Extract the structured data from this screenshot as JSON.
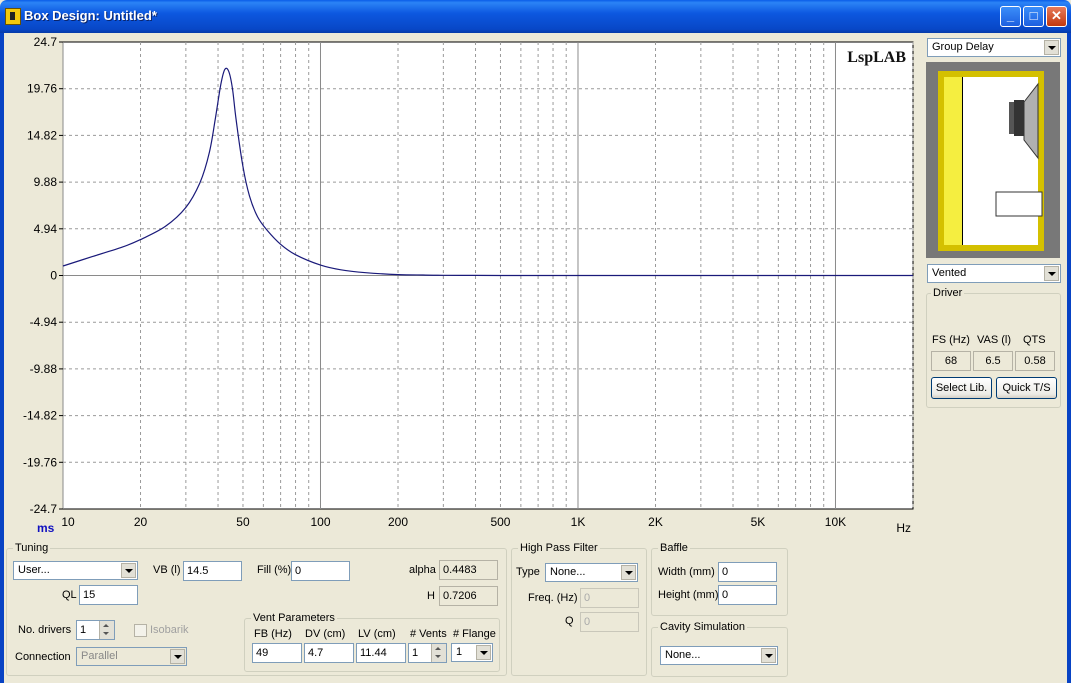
{
  "window": {
    "title": "Box Design: Untitled*",
    "minimize": "_",
    "maximize": "□",
    "close": "✕"
  },
  "chart": {
    "watermark": "LspLAB",
    "y_unit": "ms",
    "x_unit": "Hz"
  },
  "chart_data": {
    "type": "line",
    "title": "",
    "xlabel": "Hz",
    "ylabel": "ms",
    "x_scale": "log",
    "xlim": [
      10,
      20000
    ],
    "ylim": [
      -24.7,
      24.7
    ],
    "grid": true,
    "y_ticks": [
      "24.7",
      "19.76",
      "14.82",
      "9.88",
      "4.94",
      "0",
      "-4.94",
      "-9.88",
      "-14.82",
      "-19.76",
      "-24.7"
    ],
    "x_ticks": [
      {
        "v": 10,
        "label": "10"
      },
      {
        "v": 20,
        "label": "20"
      },
      {
        "v": 50,
        "label": "50"
      },
      {
        "v": 100,
        "label": "100"
      },
      {
        "v": 200,
        "label": "200"
      },
      {
        "v": 500,
        "label": "500"
      },
      {
        "v": 1000,
        "label": "1K"
      },
      {
        "v": 2000,
        "label": "2K"
      },
      {
        "v": 5000,
        "label": "5K"
      },
      {
        "v": 10000,
        "label": "10K"
      }
    ],
    "series": [
      {
        "color": "#1a1a7a",
        "x": [
          10,
          13,
          17,
          20,
          25,
          30,
          34,
          37,
          39,
          41,
          42.5,
          44,
          45.5,
          47,
          50,
          53,
          57,
          62,
          70,
          80,
          100,
          120,
          150,
          200,
          250,
          300,
          400,
          500,
          600,
          1000,
          2000,
          5000,
          20000
        ],
        "y": [
          1.0,
          2.0,
          3.0,
          3.8,
          5.2,
          7.2,
          9.8,
          13.0,
          16.5,
          20.2,
          21.8,
          21.6,
          19.8,
          16.5,
          11.5,
          8.4,
          6.2,
          4.8,
          3.3,
          2.2,
          1.1,
          0.6,
          0.3,
          0.1,
          0.05,
          0.02,
          0.01,
          0.0,
          0.0,
          0.0,
          0.0,
          0.0,
          0.0
        ]
      }
    ]
  },
  "right": {
    "graph_select": "Group Delay",
    "box_type": "Vented",
    "driver": {
      "title": "Driver",
      "fs_label": "FS (Hz)",
      "vas_label": "VAS (l)",
      "qts_label": "QTS",
      "fs": "68",
      "vas": "6.5",
      "qts": "0.58",
      "select_lib": "Select Lib.",
      "quick_ts": "Quick T/S"
    }
  },
  "tuning": {
    "title": "Tuning",
    "preset": "User...",
    "vb_label": "VB (l)",
    "vb": "14.5",
    "fill_label": "Fill (%)",
    "fill": "0",
    "ql_label": "QL",
    "ql": "15",
    "alpha_label": "alpha",
    "alpha": "0.4483",
    "h_label": "H",
    "h": "0.7206",
    "drivers_label": "No. drivers",
    "drivers": "1",
    "isobarik_label": "Isobarik",
    "connection_label": "Connection",
    "connection": "Parallel"
  },
  "vent": {
    "title": "Vent Parameters",
    "fb_label": "FB (Hz)",
    "dv_label": "DV (cm)",
    "lv_label": "LV (cm)",
    "vents_label": "# Vents",
    "flange_label": "# Flange",
    "fb": "49",
    "dv": "4.7",
    "lv": "11.44",
    "vents": "1",
    "flange": "1"
  },
  "hpf": {
    "title": "High Pass Filter",
    "type_label": "Type",
    "type": "None...",
    "freq_label": "Freq. (Hz)",
    "freq": "0",
    "q_label": "Q",
    "q": "0"
  },
  "baffle": {
    "title": "Baffle",
    "width_label": "Width (mm)",
    "width": "0",
    "height_label": "Height (mm)",
    "height": "0"
  },
  "cavity": {
    "title": "Cavity Simulation",
    "value": "None..."
  }
}
